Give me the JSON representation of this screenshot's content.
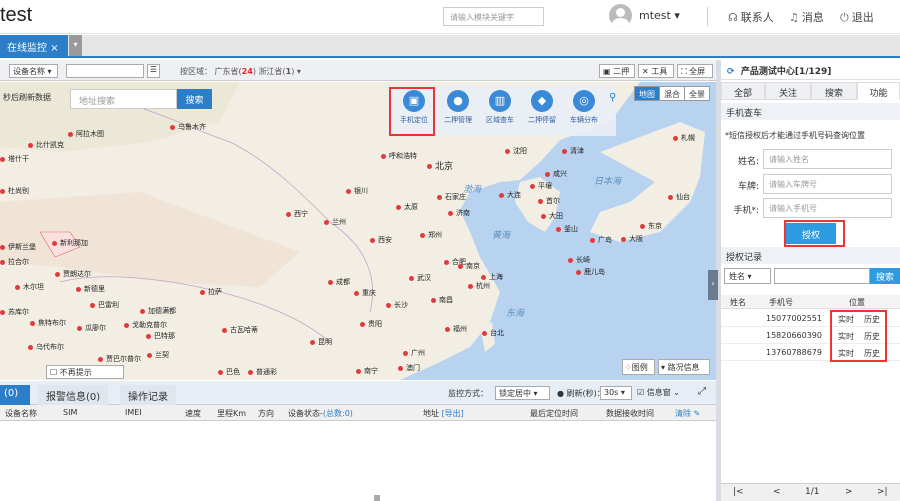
{
  "header": {
    "title": "test",
    "search_placeholder": "请输入模块关键字",
    "user": "mtest",
    "user_caret": "▾",
    "contact": "联系人",
    "messages": "消息",
    "logout": "退出"
  },
  "tabs": {
    "active": "在线监控",
    "close": "×",
    "dropdown": "▾"
  },
  "map_toolbar": {
    "device_field": "设备名称",
    "region_text": "按区域：",
    "region_1": "广东省",
    "region_1_count": "24",
    "region_2": "浙江省",
    "region_2_count": "1",
    "btn_two": "二押",
    "btn_tools": "工具",
    "btn_full": "全屏"
  },
  "map": {
    "refresh_note": "秒后刷新数据",
    "search_placeholder": "地址搜索",
    "search_btn": "搜索",
    "tools": [
      {
        "label": "手机定位",
        "icon": "phone-locate-icon",
        "glyph": "▣"
      },
      {
        "label": "二押管理",
        "icon": "pin-icon",
        "glyph": "●"
      },
      {
        "label": "区域查车",
        "icon": "area-icon",
        "glyph": "▥"
      },
      {
        "label": "二押停留",
        "icon": "stay-icon",
        "glyph": "◆"
      },
      {
        "label": "车辆分布",
        "icon": "distribution-icon",
        "glyph": "◎"
      }
    ],
    "map_types": [
      "地图",
      "混合",
      "全景"
    ],
    "legend": "图例",
    "traffic": "路况信息",
    "hint": "不再提示",
    "cities": [
      {
        "name": "乌鲁木齐"
      },
      {
        "name": "阿拉木图"
      },
      {
        "name": "比什凯克"
      },
      {
        "name": "塔什干"
      },
      {
        "name": "杜尚别"
      },
      {
        "name": "伊斯兰堡"
      },
      {
        "name": "新利那加"
      },
      {
        "name": "拉合尔"
      },
      {
        "name": "新德里"
      },
      {
        "name": "木尔坦"
      },
      {
        "name": "贾朗达尔"
      },
      {
        "name": "苏库尔"
      },
      {
        "name": "焦特布尔"
      },
      {
        "name": "巴雷利"
      },
      {
        "name": "瓜廖尔"
      },
      {
        "name": "加德满都"
      },
      {
        "name": "戈勒克普尔"
      },
      {
        "name": "巴特那"
      },
      {
        "name": "古瓦哈蒂"
      },
      {
        "name": "乌代布尔"
      },
      {
        "name": "贾巴尔普尔"
      },
      {
        "name": "兰契"
      },
      {
        "name": "拉萨"
      },
      {
        "name": "西宁"
      },
      {
        "name": "兰州"
      },
      {
        "name": "银川"
      },
      {
        "name": "呼和浩特"
      },
      {
        "name": "北京"
      },
      {
        "name": "太原"
      },
      {
        "name": "石家庄"
      },
      {
        "name": "济南"
      },
      {
        "name": "郑州"
      },
      {
        "name": "西安"
      },
      {
        "name": "成都"
      },
      {
        "name": "重庆"
      },
      {
        "name": "武汉"
      },
      {
        "name": "合肥"
      },
      {
        "name": "南京"
      },
      {
        "name": "上海"
      },
      {
        "name": "杭州"
      },
      {
        "name": "南昌"
      },
      {
        "name": "福州"
      },
      {
        "name": "长沙"
      },
      {
        "name": "贵阳"
      },
      {
        "name": "昆明"
      },
      {
        "name": "南宁"
      },
      {
        "name": "广州"
      },
      {
        "name": "澳门"
      },
      {
        "name": "台北"
      },
      {
        "name": "沈阳"
      },
      {
        "name": "大连"
      },
      {
        "name": "平壤"
      },
      {
        "name": "首尔"
      },
      {
        "name": "釜山"
      },
      {
        "name": "大田"
      },
      {
        "name": "咸兴"
      },
      {
        "name": "清津"
      },
      {
        "name": "广岛"
      },
      {
        "name": "大阪"
      },
      {
        "name": "东京"
      },
      {
        "name": "仙台"
      },
      {
        "name": "札幌"
      },
      {
        "name": "长崎"
      },
      {
        "name": "鹿儿岛"
      },
      {
        "name": "普通彩"
      },
      {
        "name": "巴色"
      }
    ],
    "seas": [
      "渤海",
      "黄海",
      "东海",
      "日本海"
    ]
  },
  "bottom": {
    "tab_online": "(0)",
    "tab_alarm": "报警信息(0)",
    "tab_ops": "操作记录",
    "monitor_label": "监控方式：",
    "monitor_value": "锁定居中",
    "refresh_label": "刷新(秒)：",
    "refresh_value": "30s",
    "msg_box": "信息窗",
    "columns": [
      "设备名称",
      "SIM",
      "IMEI",
      "速度",
      "里程Km",
      "方向",
      "设备状态-",
      "(总数:0)",
      "地址",
      "[导出]",
      "最后定位时间",
      "数据接收时间",
      "清除"
    ]
  },
  "right": {
    "title": "产品测试中心[1/129]",
    "tabs": [
      "全部",
      "关注",
      "搜索",
      "功能"
    ],
    "section_phone": "手机查车",
    "note": "*短信授权后才能通过手机号码查询位置",
    "name_label": "姓名:",
    "name_placeholder": "请输入姓名",
    "plate_label": "车牌:",
    "plate_placeholder": "请输入车牌号",
    "phone_label": "手机*:",
    "phone_placeholder": "请输入手机号",
    "auth_btn": "授权",
    "section_records": "授权记录",
    "record_select": "姓名",
    "record_search": "搜索",
    "record_headers": [
      "姓名",
      "手机号",
      "位置"
    ],
    "records": [
      {
        "name": "",
        "phone": "15077002551",
        "realtime": "实时",
        "history": "历史"
      },
      {
        "name": "",
        "phone": "15820660390",
        "realtime": "实时",
        "history": "历史"
      },
      {
        "name": "",
        "phone": "13760788679",
        "realtime": "实时",
        "history": "历史"
      }
    ],
    "pager": {
      "first": "|<",
      "prev": "<",
      "page": "1/1",
      "next": ">",
      "last": ">|"
    }
  }
}
